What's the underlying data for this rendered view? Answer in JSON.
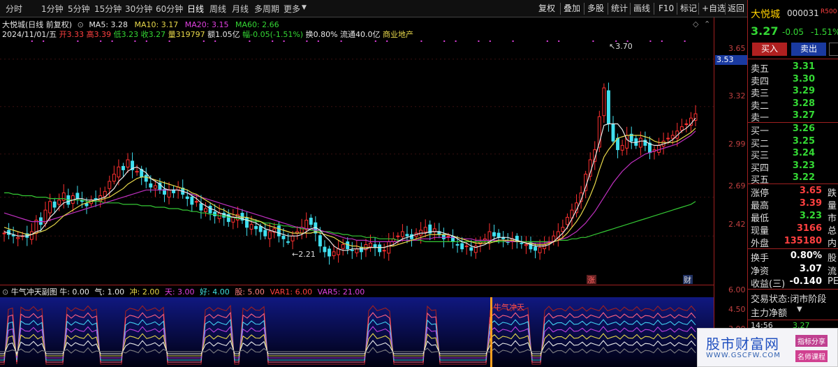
{
  "toolbar": {
    "periods": [
      "分时",
      "1分钟",
      "5分钟",
      "15分钟",
      "30分钟",
      "60分钟",
      "日线",
      "周线",
      "月线",
      "多周期",
      "更多"
    ],
    "active_period": "日线",
    "buttons": [
      "复权",
      "叠加",
      "多股",
      "统计",
      "画线",
      "F10",
      "标记",
      "+自选",
      "返回"
    ]
  },
  "info": {
    "title": "大悦城(日线 前复权)",
    "ma5_label": "MA5: 3.28",
    "ma10_label": "MA10: 3.17",
    "ma20_label": "MA20: 3.15",
    "ma60_label": "MA60: 2.66",
    "date": "2024/11/01/五",
    "open": "开3.33",
    "high": "高3.39",
    "low": "低3.23",
    "close": "收3.27",
    "volume": "量319797",
    "amount": "额1.05亿",
    "amplitude": "幅-0.05(-1.51%)",
    "turnover": "换0.80%",
    "float": "流通40.0亿",
    "sector": "商业地产"
  },
  "chart_data": {
    "type": "candlestick",
    "y_ticks": [
      "3.65",
      "3.32",
      "2.99",
      "2.69",
      "2.42"
    ],
    "current_price_tag": "3.53",
    "annotations": [
      "3.70",
      "2.21"
    ],
    "markers": [
      "涨",
      "财"
    ],
    "close": [
      2.44,
      2.43,
      2.42,
      2.41,
      2.42,
      2.41,
      2.45,
      2.53,
      2.5,
      2.6,
      2.66,
      2.62,
      2.67,
      2.72,
      2.64,
      2.7,
      2.68,
      2.66,
      2.63,
      2.67,
      2.68,
      2.7,
      2.73,
      2.8,
      2.85,
      2.9,
      2.88,
      2.95,
      2.88,
      2.87,
      2.83,
      2.8,
      2.76,
      2.77,
      2.74,
      2.71,
      2.74,
      2.72,
      2.76,
      2.71,
      2.68,
      2.64,
      2.66,
      2.6,
      2.61,
      2.58,
      2.56,
      2.58,
      2.55,
      2.52,
      2.55,
      2.57,
      2.53,
      2.48,
      2.5,
      2.47,
      2.45,
      2.42,
      2.45,
      2.47,
      2.42,
      2.4,
      2.38,
      2.42,
      2.45,
      2.48,
      2.53,
      2.5,
      2.44,
      2.35,
      2.31,
      2.28,
      2.31,
      2.33,
      2.36,
      2.33,
      2.32,
      2.33,
      2.31,
      2.36,
      2.37,
      2.34,
      2.31,
      2.32,
      2.38,
      2.4,
      2.42,
      2.45,
      2.42,
      2.4,
      2.44,
      2.46,
      2.48,
      2.44,
      2.47,
      2.43,
      2.4,
      2.42,
      2.38,
      2.36,
      2.33,
      2.35,
      2.32,
      2.35,
      2.38,
      2.4,
      2.45,
      2.42,
      2.41,
      2.4,
      2.38,
      2.4,
      2.38,
      2.37,
      2.36,
      2.33,
      2.32,
      2.34,
      2.36,
      2.38,
      2.42,
      2.45,
      2.48,
      2.55,
      2.6,
      2.65,
      2.72,
      2.85,
      2.95,
      3.02,
      3.25,
      3.45,
      3.2,
      3.08,
      3.02,
      3.05,
      3.12,
      3.08,
      3.05,
      3.1,
      3.05,
      3.0,
      3.02,
      3.05,
      3.08,
      3.1,
      3.12,
      3.15,
      3.18,
      3.2,
      3.24,
      3.27
    ],
    "ma5": [
      2.45,
      2.44,
      2.43,
      2.42,
      2.42,
      2.42,
      2.43,
      2.45,
      2.46,
      2.5,
      2.55,
      2.58,
      2.62,
      2.65,
      2.66,
      2.67,
      2.68,
      2.68,
      2.67,
      2.67,
      2.67,
      2.68,
      2.69,
      2.72,
      2.75,
      2.8,
      2.83,
      2.87,
      2.89,
      2.9,
      2.88,
      2.86,
      2.82,
      2.8,
      2.78,
      2.75,
      2.74,
      2.74,
      2.74,
      2.73,
      2.72,
      2.7,
      2.68,
      2.65,
      2.63,
      2.61,
      2.6,
      2.58,
      2.57,
      2.56,
      2.55,
      2.55,
      2.54,
      2.53,
      2.52,
      2.51,
      2.49,
      2.47,
      2.46,
      2.45,
      2.44,
      2.43,
      2.42,
      2.42,
      2.42,
      2.43,
      2.45,
      2.47,
      2.48,
      2.46,
      2.42,
      2.39,
      2.35,
      2.33,
      2.32,
      2.32,
      2.33,
      2.33,
      2.33,
      2.33,
      2.34,
      2.34,
      2.34,
      2.34,
      2.35,
      2.36,
      2.38,
      2.4,
      2.41,
      2.42,
      2.43,
      2.44,
      2.44,
      2.45,
      2.45,
      2.45,
      2.44,
      2.43,
      2.42,
      2.4,
      2.38,
      2.37,
      2.35,
      2.34,
      2.35,
      2.36,
      2.38,
      2.4,
      2.41,
      2.41,
      2.41,
      2.4,
      2.39,
      2.38,
      2.37,
      2.36,
      2.35,
      2.35,
      2.35,
      2.36,
      2.38,
      2.41,
      2.44,
      2.48,
      2.54,
      2.6,
      2.67,
      2.76,
      2.86,
      2.96,
      3.07,
      3.19,
      3.2,
      3.2,
      3.2,
      3.16,
      3.09,
      3.07,
      3.07,
      3.08,
      3.08,
      3.06,
      3.05,
      3.05,
      3.06,
      3.07,
      3.09,
      3.12,
      3.15,
      3.17,
      3.2,
      3.24
    ],
    "ma10": [
      2.48,
      2.47,
      2.46,
      2.45,
      2.44,
      2.43,
      2.43,
      2.44,
      2.45,
      2.46,
      2.48,
      2.5,
      2.53,
      2.56,
      2.58,
      2.6,
      2.62,
      2.64,
      2.65,
      2.66,
      2.67,
      2.67,
      2.68,
      2.69,
      2.71,
      2.73,
      2.75,
      2.78,
      2.8,
      2.82,
      2.83,
      2.83,
      2.82,
      2.81,
      2.8,
      2.79,
      2.78,
      2.77,
      2.76,
      2.75,
      2.74,
      2.72,
      2.71,
      2.69,
      2.67,
      2.65,
      2.63,
      2.61,
      2.6,
      2.58,
      2.57,
      2.56,
      2.55,
      2.55,
      2.54,
      2.53,
      2.52,
      2.5,
      2.49,
      2.48,
      2.47,
      2.46,
      2.45,
      2.44,
      2.44,
      2.44,
      2.44,
      2.44,
      2.45,
      2.44,
      2.43,
      2.42,
      2.41,
      2.39,
      2.37,
      2.36,
      2.35,
      2.35,
      2.34,
      2.34,
      2.34,
      2.34,
      2.34,
      2.34,
      2.35,
      2.35,
      2.36,
      2.37,
      2.38,
      2.39,
      2.4,
      2.41,
      2.42,
      2.43,
      2.43,
      2.43,
      2.43,
      2.43,
      2.42,
      2.41,
      2.4,
      2.39,
      2.38,
      2.37,
      2.37,
      2.37,
      2.37,
      2.38,
      2.39,
      2.39,
      2.39,
      2.39,
      2.38,
      2.38,
      2.37,
      2.37,
      2.36,
      2.36,
      2.36,
      2.37,
      2.38,
      2.39,
      2.41,
      2.44,
      2.48,
      2.52,
      2.57,
      2.63,
      2.7,
      2.78,
      2.88,
      2.97,
      3.02,
      3.06,
      3.1,
      3.11,
      3.12,
      3.12,
      3.12,
      3.12,
      3.11,
      3.1,
      3.08,
      3.07,
      3.07,
      3.07,
      3.07,
      3.08,
      3.1,
      3.12,
      3.14,
      3.17
    ],
    "ma20": [
      2.58,
      2.57,
      2.56,
      2.55,
      2.54,
      2.53,
      2.52,
      2.52,
      2.52,
      2.52,
      2.53,
      2.54,
      2.55,
      2.56,
      2.57,
      2.58,
      2.59,
      2.6,
      2.61,
      2.62,
      2.63,
      2.64,
      2.65,
      2.66,
      2.67,
      2.68,
      2.69,
      2.7,
      2.71,
      2.72,
      2.73,
      2.74,
      2.74,
      2.74,
      2.74,
      2.74,
      2.74,
      2.74,
      2.74,
      2.73,
      2.72,
      2.71,
      2.7,
      2.69,
      2.68,
      2.67,
      2.66,
      2.65,
      2.64,
      2.63,
      2.62,
      2.61,
      2.6,
      2.59,
      2.58,
      2.57,
      2.56,
      2.55,
      2.54,
      2.53,
      2.52,
      2.51,
      2.5,
      2.49,
      2.48,
      2.48,
      2.47,
      2.47,
      2.46,
      2.46,
      2.45,
      2.44,
      2.43,
      2.42,
      2.41,
      2.4,
      2.4,
      2.39,
      2.39,
      2.39,
      2.38,
      2.38,
      2.38,
      2.38,
      2.38,
      2.38,
      2.38,
      2.39,
      2.39,
      2.39,
      2.39,
      2.4,
      2.4,
      2.4,
      2.41,
      2.41,
      2.41,
      2.41,
      2.41,
      2.41,
      2.4,
      2.4,
      2.4,
      2.39,
      2.39,
      2.39,
      2.39,
      2.39,
      2.39,
      2.39,
      2.38,
      2.38,
      2.38,
      2.38,
      2.37,
      2.37,
      2.37,
      2.37,
      2.37,
      2.38,
      2.38,
      2.39,
      2.4,
      2.41,
      2.43,
      2.45,
      2.48,
      2.51,
      2.55,
      2.59,
      2.64,
      2.69,
      2.74,
      2.79,
      2.83,
      2.87,
      2.9,
      2.93,
      2.95,
      2.97,
      2.99,
      3.0,
      3.01,
      3.02,
      3.03,
      3.04,
      3.05,
      3.06,
      3.08,
      3.1,
      3.12,
      3.15
    ],
    "ma60": [
      2.72,
      2.72,
      2.71,
      2.71,
      2.7,
      2.7,
      2.7,
      2.69,
      2.69,
      2.69,
      2.68,
      2.68,
      2.68,
      2.68,
      2.67,
      2.67,
      2.67,
      2.67,
      2.66,
      2.66,
      2.66,
      2.66,
      2.65,
      2.65,
      2.65,
      2.65,
      2.64,
      2.64,
      2.64,
      2.64,
      2.63,
      2.63,
      2.63,
      2.62,
      2.62,
      2.62,
      2.61,
      2.61,
      2.61,
      2.6,
      2.6,
      2.59,
      2.59,
      2.58,
      2.58,
      2.57,
      2.57,
      2.56,
      2.56,
      2.55,
      2.55,
      2.54,
      2.54,
      2.53,
      2.53,
      2.52,
      2.52,
      2.51,
      2.51,
      2.5,
      2.5,
      2.49,
      2.49,
      2.48,
      2.48,
      2.47,
      2.47,
      2.46,
      2.46,
      2.45,
      2.45,
      2.45,
      2.44,
      2.44,
      2.43,
      2.43,
      2.42,
      2.42,
      2.42,
      2.41,
      2.41,
      2.41,
      2.4,
      2.4,
      2.4,
      2.4,
      2.39,
      2.39,
      2.39,
      2.39,
      2.39,
      2.39,
      2.38,
      2.38,
      2.38,
      2.38,
      2.38,
      2.38,
      2.38,
      2.38,
      2.38,
      2.38,
      2.38,
      2.38,
      2.38,
      2.38,
      2.38,
      2.38,
      2.38,
      2.38,
      2.38,
      2.38,
      2.38,
      2.38,
      2.38,
      2.38,
      2.38,
      2.38,
      2.38,
      2.38,
      2.38,
      2.39,
      2.39,
      2.39,
      2.4,
      2.4,
      2.41,
      2.41,
      2.42,
      2.43,
      2.44,
      2.45,
      2.46,
      2.47,
      2.48,
      2.49,
      2.5,
      2.51,
      2.52,
      2.53,
      2.54,
      2.55,
      2.56,
      2.57,
      2.58,
      2.59,
      2.6,
      2.61,
      2.62,
      2.63,
      2.64,
      2.66
    ]
  },
  "sub": {
    "title": "牛气冲天副图",
    "n_niu": "牛: 0.00",
    "n_qi": "气: 1.00",
    "n_chong": "冲: 2.00",
    "n_tian": "天: 3.00",
    "n_hao": "好: 4.00",
    "n_gu": "股: 5.00",
    "var1": "VAR1: 6.00",
    "var5": "VAR5: 21.00",
    "signal": "牛气冲天",
    "axis": [
      "6.00",
      "4.50",
      "3.00"
    ]
  },
  "panel": {
    "name": "大悦城",
    "code": "000031",
    "r500": "R500",
    "price": "3.27",
    "change": "-0.05",
    "pct": "-1.51%",
    "buy": "买入",
    "sell": "卖出",
    "sells": [
      {
        "l": "卖五",
        "v": "3.31"
      },
      {
        "l": "卖四",
        "v": "3.30"
      },
      {
        "l": "卖三",
        "v": "3.29"
      },
      {
        "l": "卖二",
        "v": "3.28"
      },
      {
        "l": "卖一",
        "v": "3.27"
      }
    ],
    "buys": [
      {
        "l": "买一",
        "v": "3.26"
      },
      {
        "l": "买二",
        "v": "3.25"
      },
      {
        "l": "买三",
        "v": "3.24"
      },
      {
        "l": "买四",
        "v": "3.23"
      },
      {
        "l": "买五",
        "v": "3.22"
      }
    ],
    "stats1": [
      {
        "l": "涨停",
        "v": "3.65",
        "s": "跌",
        "c": "#ff4040"
      },
      {
        "l": "最高",
        "v": "3.39",
        "s": "量",
        "c": "#ff4040"
      },
      {
        "l": "最低",
        "v": "3.23",
        "s": "市",
        "c": "#34d834"
      },
      {
        "l": "现量",
        "v": "3166",
        "s": "总",
        "c": "#ff4040"
      },
      {
        "l": "外盘",
        "v": "135180",
        "s": "内",
        "c": "#ff4040"
      }
    ],
    "stats2": [
      {
        "l": "换手",
        "v": "0.80%",
        "s": "股",
        "c": "#ffffff"
      },
      {
        "l": "净资",
        "v": "3.07",
        "s": "流",
        "c": "#ffffff"
      },
      {
        "l": "收益(三)",
        "v": "-0.140",
        "s": "PE",
        "c": "#ffffff"
      }
    ],
    "trade_status": "交易状态:闭市阶段",
    "net_flow": "主力净额",
    "time": "14:56",
    "time_price": "3.27"
  },
  "watermark": {
    "main": "股市财富网",
    "url": "WWW.GSCFW.COM",
    "tag1": "指标分享",
    "tag2": "名师课程"
  }
}
